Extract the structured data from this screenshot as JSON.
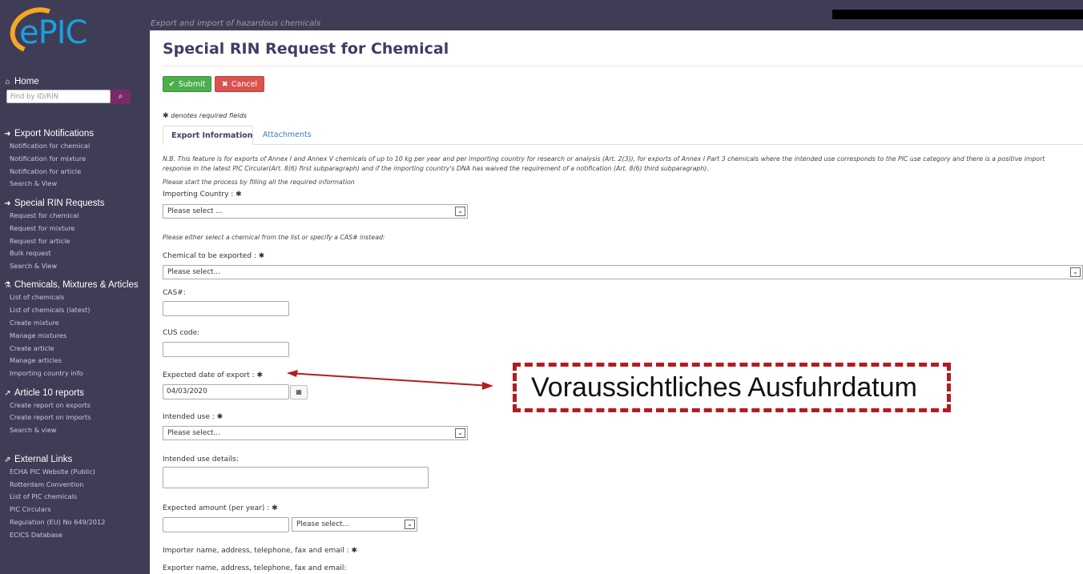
{
  "app": {
    "logo_text": "ePIC",
    "tagline": "Export and import of hazardous chemicals"
  },
  "sidebar": {
    "home_label": "Home",
    "find_placeholder": "Find by ID/RIN",
    "sections": [
      {
        "title": "Export Notifications",
        "icon": "arrow-circle-right-icon",
        "items": [
          "Notification for chemical",
          "Notification for mixture",
          "Notification for article",
          "Search & View"
        ]
      },
      {
        "title": "Special RIN Requests",
        "icon": "arrow-circle-right-icon",
        "items": [
          "Request for chemical",
          "Request for mixture",
          "Request for article",
          "Bulk request",
          "Search & View"
        ]
      },
      {
        "title": "Chemicals, Mixtures & Articles",
        "icon": "flask-icon",
        "items": [
          "List of chemicals",
          "List of chemicals (latest)",
          "Create mixture",
          "Manage mixtures",
          "Create article",
          "Manage articles",
          "Importing country info"
        ]
      },
      {
        "title": "Article 10 reports",
        "icon": "line-chart-icon",
        "items": [
          "Create report on exports",
          "Create report on imports",
          "Search & view"
        ]
      },
      {
        "title": "External Links",
        "icon": "external-link-icon",
        "items": [
          "ECHA PIC Website (Public)",
          "Rotterdam Convention",
          "List of PIC chemicals",
          "PIC Circulars",
          "Regulation (EU) No 649/2012",
          "ECICS Database"
        ]
      }
    ]
  },
  "page": {
    "title": "Special RIN Request for Chemical",
    "submit_label": "Submit",
    "cancel_label": "Cancel",
    "required_note": "denotes required fields",
    "tabs": [
      "Export Information",
      "Attachments"
    ],
    "nb_line1": "N.B. This feature is for exports of Annex I and Annex V chemicals of up to 10 kg per year and per importing country for research or analysis (Art. 2(3)), for exports of Annex I Part 3 chemicals where the intended use corresponds to the PIC use category and there is a positive import",
    "nb_line2": "response in the latest PIC Circular(Art. 8(6) first subparagraph) and if the importing country's DNA has waived the requirement of a notification (Art. 8(6) third subparagraph).",
    "start_note": "Please start the process by filling all the required information",
    "either_note": "Please either select a chemical from the list or specify a CAS# instead:"
  },
  "form": {
    "importing_country_label": "Importing Country :",
    "importing_country_value": "Please select ...",
    "chemical_label": "Chemical to be exported :",
    "chemical_value": "Please select...",
    "cas_label": "CAS#:",
    "cas_value": "",
    "cus_label": "CUS code:",
    "cus_value": "",
    "export_date_label": "Expected date of export :",
    "export_date_value": "04/03/2020",
    "intended_use_label": "Intended use :",
    "intended_use_value": "Please select...",
    "intended_use_details_label": "Intended use details:",
    "amount_label": "Expected amount (per year) :",
    "amount_value": "",
    "amount_unit_value": "Please select...",
    "importer_label": "Importer name, address, telephone, fax and email :",
    "exporter_label": "Exporter name, address, telephone, fax and email:"
  },
  "annotation": {
    "text": "Voraussichtliches Ausfuhrdatum",
    "color": "#b01c24"
  }
}
